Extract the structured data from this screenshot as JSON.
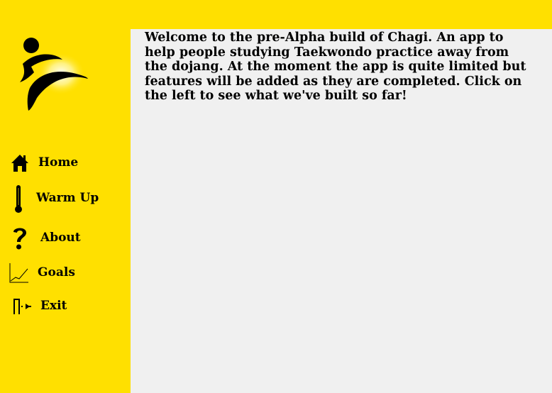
{
  "app": {
    "name": "Chagi",
    "colors": {
      "sidebar_bg": "#FFE000",
      "content_bg": "#F0F0F0",
      "text": "#000000"
    }
  },
  "logo": {
    "icon": "kicking-figure-logo"
  },
  "nav": {
    "items": [
      {
        "label": "Home",
        "icon": "home-icon"
      },
      {
        "label": "Warm Up",
        "icon": "thermometer-icon"
      },
      {
        "label": "About",
        "icon": "question-mark-icon"
      },
      {
        "label": "Goals",
        "icon": "line-graph-icon"
      },
      {
        "label": "Exit",
        "icon": "exit-door-icon"
      }
    ]
  },
  "main": {
    "welcome_text": "Welcome to the pre-Alpha build of Chagi. An app to help people studying Taekwondo practice away from the dojang. At the moment the app is quite limited but features will be added as they are completed. Click on the left to see what we've built so far!"
  }
}
